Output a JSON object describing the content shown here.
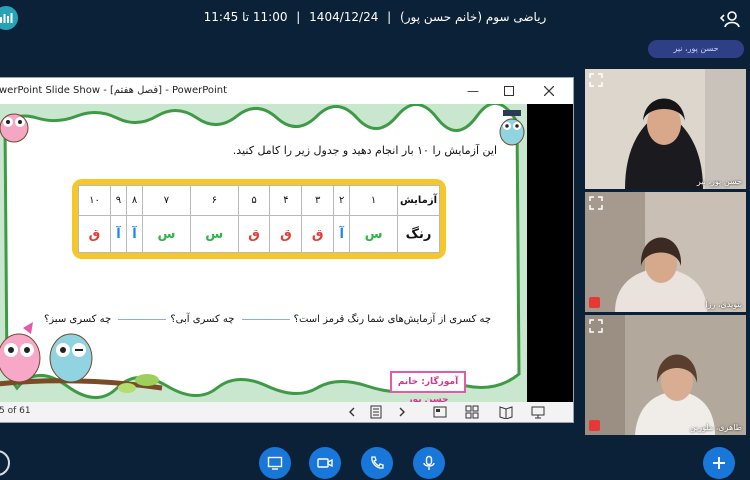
{
  "meeting": {
    "title_subject": "ریاضی سوم (خانم حسن پور)",
    "date": "1404/12/24",
    "time_range": "11:00 تا 11:45",
    "separator": "|"
  },
  "speaker_chip": "حسن پور، نیر",
  "powerpoint": {
    "window_title": "werPoint Slide Show - [فصل هفتم] - PowerPoint",
    "slide_counter": "5 of 61",
    "question": "این آزمایش را ۱۰ بار انجام دهید و جدول زیر را کامل کنید.",
    "table_header_label": "آزمایش",
    "table_row_label": "رنگ",
    "trial_numbers": [
      "۱",
      "۲",
      "۳",
      "۴",
      "۵",
      "۶",
      "۷",
      "۸",
      "۹",
      "۱۰"
    ],
    "results": [
      {
        "letter": "س",
        "color": "#2db54a"
      },
      {
        "letter": "آ",
        "color": "#1e88e5"
      },
      {
        "letter": "ق",
        "color": "#e53935"
      },
      {
        "letter": "ق",
        "color": "#e53935"
      },
      {
        "letter": "ق",
        "color": "#e53935"
      },
      {
        "letter": "س",
        "color": "#2db54a"
      },
      {
        "letter": "س",
        "color": "#2db54a"
      },
      {
        "letter": "آ",
        "color": "#1e88e5"
      },
      {
        "letter": "آ",
        "color": "#1e88e5"
      },
      {
        "letter": "ق",
        "color": "#e53935"
      }
    ],
    "question_red": "چه کسری از آزمایش‌های شما رنگ قرمز است؟",
    "question_blue": "چه کسری آبی؟",
    "question_green": "چه کسری سبز؟",
    "teacher_label": "آموزگار: خانم حسن پور"
  },
  "participants": [
    {
      "name": "حسن پور، نیر",
      "bg": "#d9d2c8"
    },
    {
      "name": "بنویدی، رزا",
      "bg": "#b7ad9f"
    },
    {
      "name": "طاهری، ملورین",
      "bg": "#a29689"
    }
  ],
  "colors": {
    "background": "#0b2137",
    "accent_blue": "#1877d9",
    "chip_bg": "#2f3f86",
    "table_frame": "#f5c72a",
    "teacher_border": "#e35aa8"
  },
  "controls": [
    "screen-share-icon",
    "camera-icon",
    "phone-icon",
    "microphone-icon",
    "plus-icon"
  ]
}
